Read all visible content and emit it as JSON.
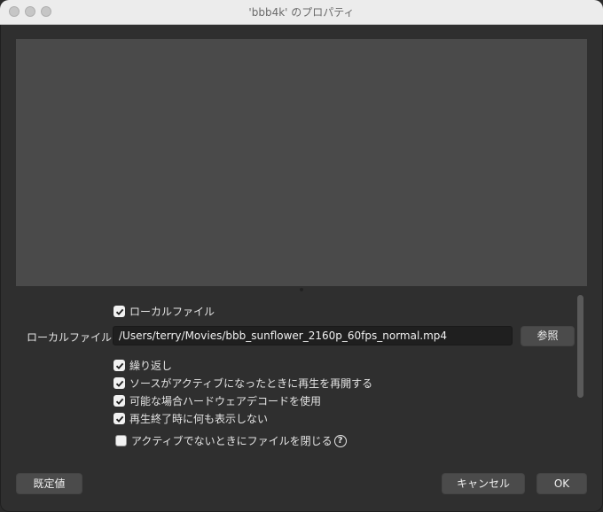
{
  "window": {
    "title": "'bbb4k' のプロパティ"
  },
  "local_file_toggle": {
    "label": "ローカルファイル",
    "checked": true
  },
  "local_file": {
    "label": "ローカルファイル",
    "path": "/Users/terry/Movies/bbb_sunflower_2160p_60fps_normal.mp4",
    "browse_label": "参照"
  },
  "options": [
    {
      "label": "繰り返し",
      "checked": true
    },
    {
      "label": "ソースがアクティブになったときに再生を再開する",
      "checked": true
    },
    {
      "label": "可能な場合ハードウェアデコードを使用",
      "checked": true
    },
    {
      "label": "再生終了時に何も表示しない",
      "checked": true
    },
    {
      "label": "アクティブでないときにファイルを閉じる",
      "checked": false
    }
  ],
  "help_glyph": "?",
  "footer": {
    "defaults_label": "既定値",
    "cancel_label": "キャンセル",
    "ok_label": "OK"
  }
}
